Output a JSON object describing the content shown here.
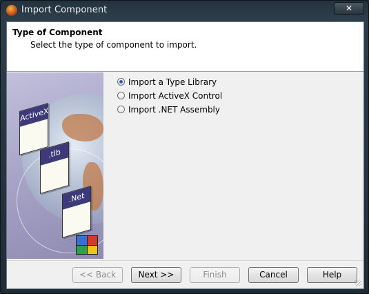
{
  "window": {
    "title": "Import Component",
    "close_glyph": "✕"
  },
  "header": {
    "title": "Type of Component",
    "subtitle": "Select the type of component to import."
  },
  "banner": {
    "cards": [
      "ActiveX",
      ".tlb",
      ".Net"
    ]
  },
  "options": [
    {
      "label": "Import a Type Library",
      "checked": true
    },
    {
      "label": "Import ActiveX Control",
      "checked": false
    },
    {
      "label": "Import .NET Assembly",
      "checked": false
    }
  ],
  "buttons": {
    "back": "<< Back",
    "next": "Next >>",
    "finish": "Finish",
    "cancel": "Cancel",
    "help": "Help"
  },
  "colors": {
    "accent": "#2d5fa8",
    "banner": "#a9a6c8",
    "card_label": "#3d3a7c"
  },
  "icons": {
    "app": "delphi-helmet-icon",
    "close": "close-icon",
    "logo": "windows-flag-icon",
    "grip": "resize-grip-icon"
  }
}
